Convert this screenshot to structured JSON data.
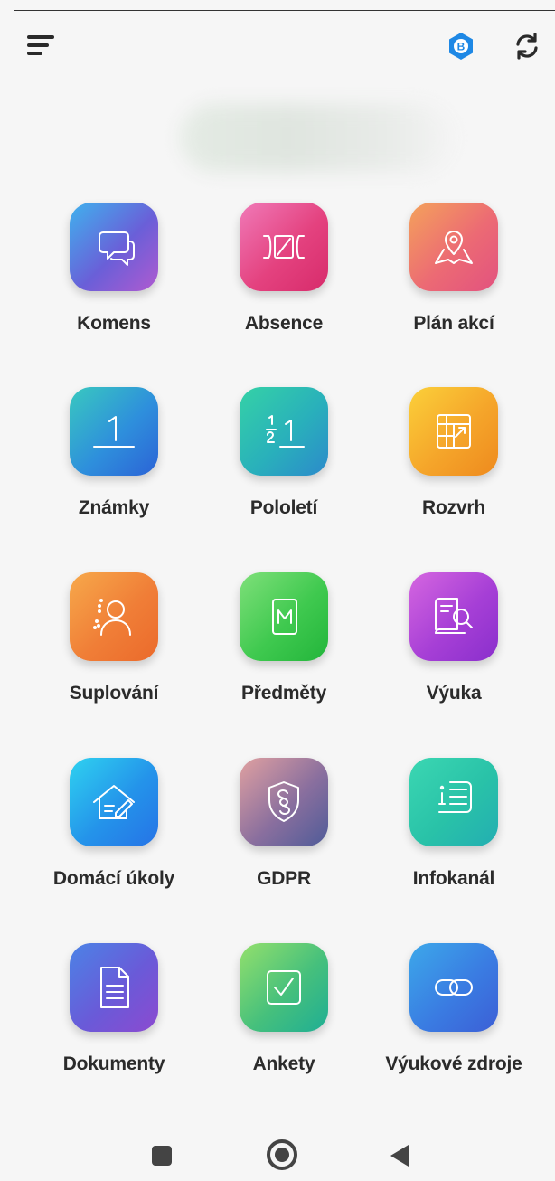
{
  "header": {
    "menu_icon": "hamburger-menu-icon",
    "brand_icon": "bakalari-logo-icon",
    "brand_color": "#1e88e5",
    "refresh_icon": "refresh-icon"
  },
  "modules": [
    {
      "label": "Komens",
      "icon": "chat-bubbles-icon",
      "gradient": [
        "#3fb2ee",
        "#6a5fd8",
        "#b05ad0"
      ]
    },
    {
      "label": "Absence",
      "icon": "absence-icon",
      "gradient": [
        "#f07ab8",
        "#e4427f",
        "#d72b6b"
      ]
    },
    {
      "label": "Plán akcí",
      "icon": "map-pin-icon",
      "gradient": [
        "#f4a25b",
        "#ec6a74",
        "#e2527f"
      ]
    },
    {
      "label": "Známky",
      "icon": "grade-one-icon",
      "gradient": [
        "#39c9bf",
        "#2e8fdc",
        "#2c63d6"
      ]
    },
    {
      "label": "Pololetí",
      "icon": "half-term-icon",
      "gradient": [
        "#35d2a6",
        "#29b0bb",
        "#2c8acb"
      ]
    },
    {
      "label": "Rozvrh",
      "icon": "timetable-icon",
      "gradient": [
        "#fbd03a",
        "#f5a52a",
        "#ee8a1e"
      ]
    },
    {
      "label": "Suplování",
      "icon": "substitute-person-icon",
      "gradient": [
        "#f7a94b",
        "#f07e37",
        "#eb6a2b"
      ]
    },
    {
      "label": "Předměty",
      "icon": "subject-card-icon",
      "gradient": [
        "#7fe07a",
        "#3fc94f",
        "#23b53b"
      ]
    },
    {
      "label": "Výuka",
      "icon": "book-search-icon",
      "gradient": [
        "#d566e0",
        "#a63fd6",
        "#8a2fcc"
      ]
    },
    {
      "label": "Domácí úkoly",
      "icon": "homework-house-icon",
      "gradient": [
        "#2fd2f0",
        "#2493ea",
        "#2673e6"
      ]
    },
    {
      "label": "GDPR",
      "icon": "gdpr-shield-icon",
      "gradient": [
        "#e1a1a1",
        "#8a6f9e",
        "#4f5b98"
      ]
    },
    {
      "label": "Infokanál",
      "icon": "info-list-icon",
      "gradient": [
        "#3bd7b2",
        "#29c2a8",
        "#23aeb2"
      ]
    },
    {
      "label": "Dokumenty",
      "icon": "document-icon",
      "gradient": [
        "#4b83e6",
        "#6a5ad8",
        "#8c4ad0"
      ]
    },
    {
      "label": "Ankety",
      "icon": "poll-checkbox-icon",
      "gradient": [
        "#94e06c",
        "#46c07c",
        "#1fae94"
      ]
    },
    {
      "label": "Výukové zdroje",
      "icon": "link-icon",
      "gradient": [
        "#3ca8ea",
        "#3a7ce2",
        "#3c5fd6"
      ]
    }
  ],
  "system_nav": {
    "recent_icon": "recent-apps-icon",
    "home_icon": "home-icon",
    "back_icon": "back-icon"
  }
}
